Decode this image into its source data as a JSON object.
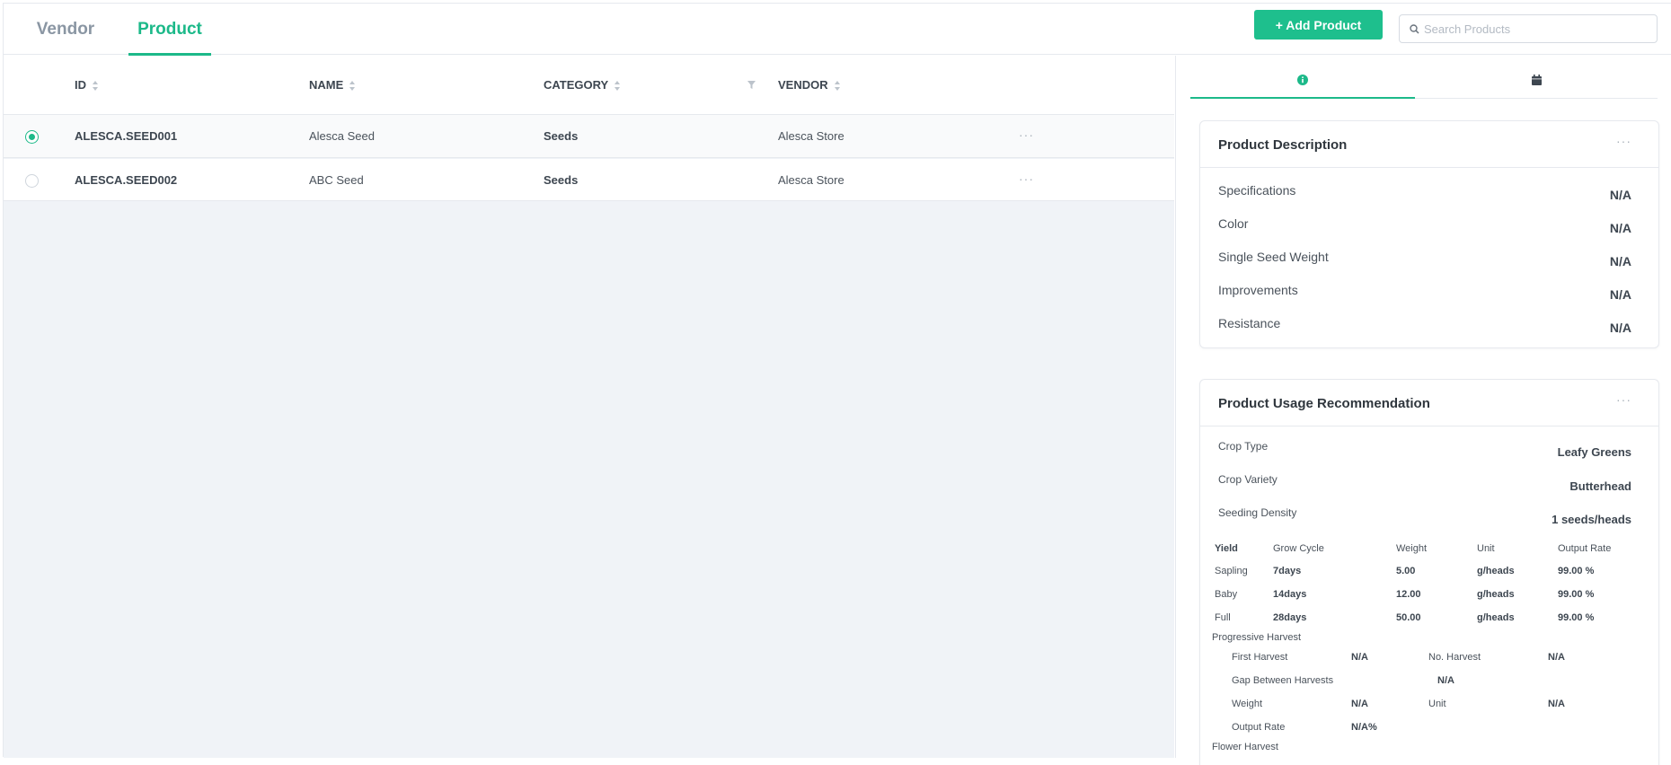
{
  "tabs": {
    "vendor": "Vendor",
    "product": "Product"
  },
  "toolbar": {
    "add_label": "+ Add Product",
    "search_placeholder": "Search Products"
  },
  "table": {
    "columns": {
      "id": "ID",
      "name": "NAME",
      "category": "CATEGORY",
      "vendor": "VENDOR"
    },
    "rows": [
      {
        "id": "ALESCA.SEED001",
        "name": "Alesca Seed",
        "category": "Seeds",
        "vendor": "Alesca Store",
        "selected": true
      },
      {
        "id": "ALESCA.SEED002",
        "name": "ABC Seed",
        "category": "Seeds",
        "vendor": "Alesca Store",
        "selected": false
      }
    ],
    "more": "···"
  },
  "panel": {
    "description": {
      "title": "Product Description",
      "more": "···",
      "items": [
        {
          "label": "Specifications",
          "value": "N/A"
        },
        {
          "label": "Color",
          "value": "N/A"
        },
        {
          "label": "Single Seed Weight",
          "value": "N/A"
        },
        {
          "label": "Improvements",
          "value": "N/A"
        },
        {
          "label": "Resistance",
          "value": "N/A"
        }
      ]
    },
    "usage": {
      "title": "Product Usage Recommendation",
      "more": "···",
      "items": [
        {
          "label": "Crop Type",
          "value": "Leafy Greens"
        },
        {
          "label": "Crop Variety",
          "value": "Butterhead"
        },
        {
          "label": "Seeding Density",
          "value": "1 seeds/heads"
        }
      ],
      "yield": {
        "headers": {
          "yield": "Yield",
          "cycle": "Grow Cycle",
          "weight": "Weight",
          "unit": "Unit",
          "rate": "Output Rate"
        },
        "rows": [
          {
            "stage": "Sapling",
            "cycle": "7days",
            "weight": "5.00",
            "unit": "g/heads",
            "rate": "99.00 %"
          },
          {
            "stage": "Baby",
            "cycle": "14days",
            "weight": "12.00",
            "unit": "g/heads",
            "rate": "99.00 %"
          },
          {
            "stage": "Full",
            "cycle": "28days",
            "weight": "50.00",
            "unit": "g/heads",
            "rate": "99.00 %"
          }
        ]
      },
      "progressive": {
        "title": "Progressive Harvest",
        "first_label": "First Harvest",
        "first_value": "N/A",
        "no_label": "No. Harvest",
        "no_value": "N/A",
        "gap_label": "Gap Between Harvests",
        "gap_value": "N/A",
        "weight_label": "Weight",
        "weight_value": "N/A",
        "unit_label": "Unit",
        "unit_value": "N/A",
        "rate_label": "Output Rate",
        "rate_value": "N/A%"
      },
      "flower_title": "Flower Harvest"
    }
  },
  "colors": {
    "accent": "#1cb989",
    "button": "#1ebf8d",
    "table_bg": "#f0f3f7"
  }
}
